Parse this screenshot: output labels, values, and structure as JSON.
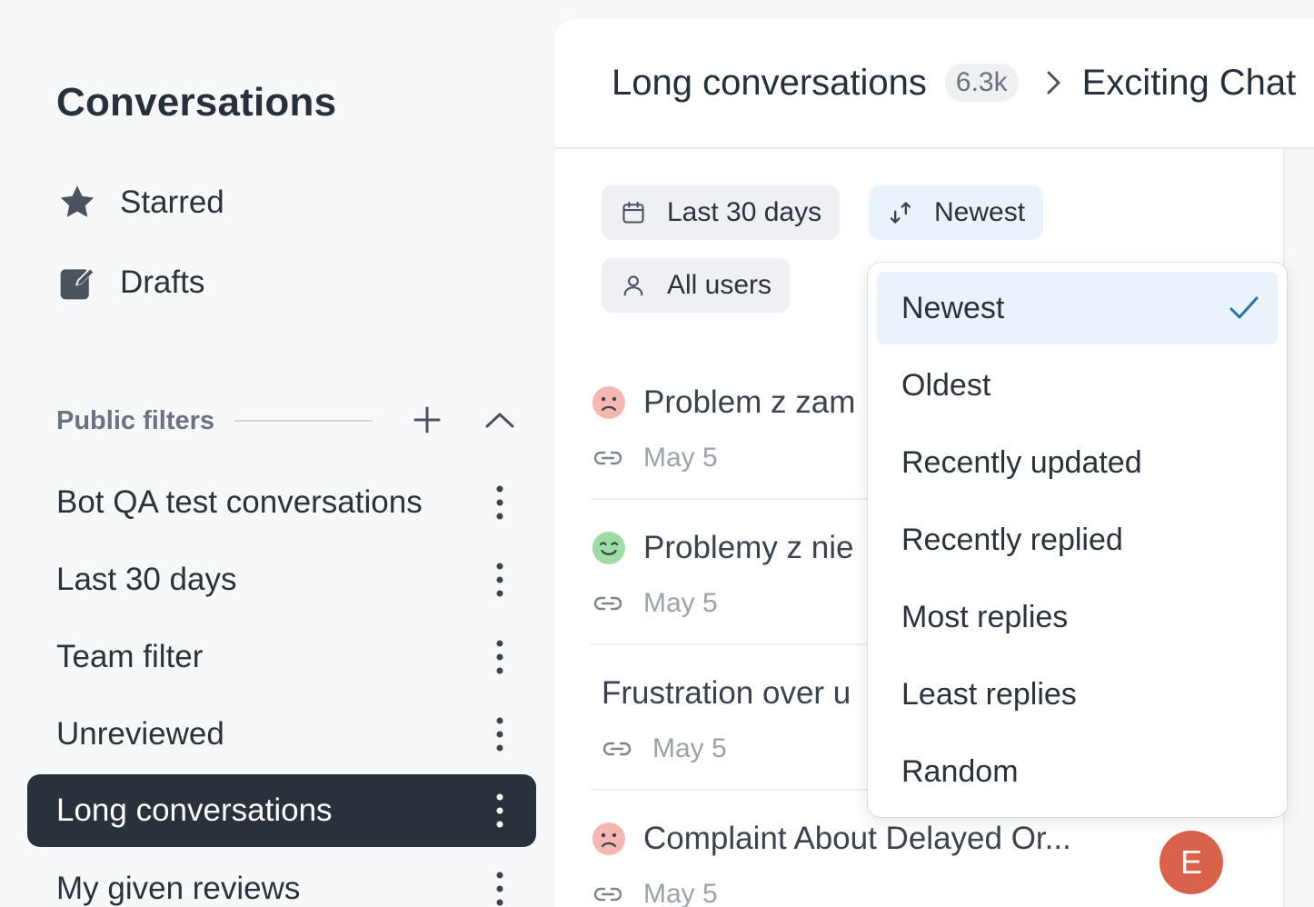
{
  "sidebar": {
    "title": "Conversations",
    "nav": [
      {
        "label": "Starred",
        "icon": "star-icon"
      },
      {
        "label": "Drafts",
        "icon": "edit-draft-icon"
      }
    ],
    "section_label": "Public filters",
    "filters": [
      {
        "label": "Bot QA test conversations",
        "active": false
      },
      {
        "label": "Last 30 days",
        "active": false
      },
      {
        "label": "Team filter",
        "active": false
      },
      {
        "label": "Unreviewed",
        "active": false
      },
      {
        "label": "Long conversations",
        "active": true
      },
      {
        "label": "My given reviews",
        "active": false
      }
    ]
  },
  "header": {
    "title": "Long conversations",
    "count": "6.3k",
    "crumb": "Exciting Chat"
  },
  "chips": {
    "date_range": "Last 30 days",
    "sort": "Newest",
    "users": "All users"
  },
  "conversations": [
    {
      "title": "Problem z zam",
      "date": "May 5",
      "sentiment": "negative"
    },
    {
      "title": "Problemy z nie",
      "date": "May 5",
      "sentiment": "positive"
    },
    {
      "title": "Frustration over u",
      "date": "May 5",
      "sentiment": "none"
    },
    {
      "title": "Complaint About Delayed Or...",
      "date": "May 5",
      "sentiment": "negative"
    }
  ],
  "avatar_initial": "E",
  "sort_menu": {
    "selected": "Newest",
    "options": [
      "Newest",
      "Oldest",
      "Recently updated",
      "Recently replied",
      "Most replies",
      "Least replies",
      "Random"
    ]
  },
  "colors": {
    "active_filter_bg": "#29313b",
    "selected_option_bg": "#eaf3fb",
    "check_color": "#2f6fa8",
    "avatar_bg": "#d9634a",
    "sad_face": "#f5b7b1",
    "happy_face": "#9fdca4"
  }
}
